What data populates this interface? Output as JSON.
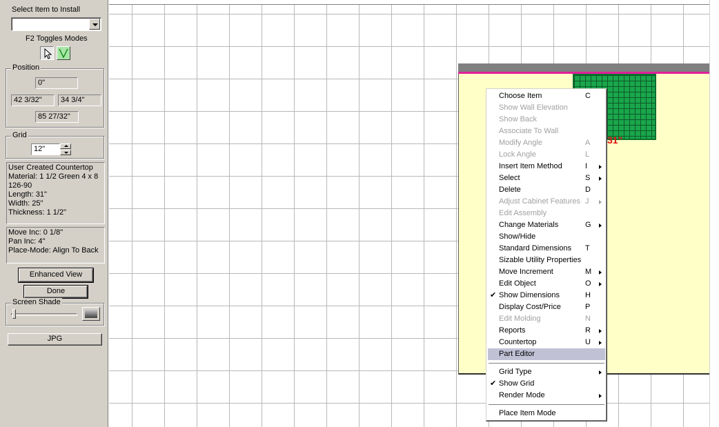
{
  "left_panel": {
    "select_item_label": "Select Item to Install",
    "select_item_value": "",
    "f2_toggles_label": "F2 Toggles Modes",
    "position": {
      "title": "Position",
      "z": "0\"",
      "x": "42 3/32\"",
      "y": "34 3/4\"",
      "h": "85 27/32\""
    },
    "grid": {
      "title": "Grid",
      "value": "12\""
    },
    "item_info": [
      "User Created Countertop",
      "Material: 1 1/2 Green 4 x 8",
      "126-90",
      "Length: 31\"",
      "Width: 25\"",
      "Thickness: 1 1/2\""
    ],
    "status_info": [
      "Move Inc: 0 1/8\"",
      "Pan Inc: 4\"",
      "Place-Mode: Align To Back"
    ],
    "enhanced_view_label": "Enhanced View",
    "done_label": "Done",
    "screen_shade_title": "Screen Shade",
    "jpg_label": "JPG"
  },
  "canvas": {
    "dimension_label": "31\"",
    "colors": {
      "countertop": "#ffffc8",
      "wall_line": "#e0209a",
      "green_material": "#1aa64b"
    }
  },
  "context_menu": {
    "items": [
      {
        "label": "Choose Item",
        "shortcut": "C",
        "enabled": true
      },
      {
        "label": "Show Wall Elevation",
        "shortcut": "",
        "enabled": false
      },
      {
        "label": "Show Back",
        "shortcut": "",
        "enabled": false
      },
      {
        "label": "Associate To Wall",
        "shortcut": "",
        "enabled": false
      },
      {
        "label": "Modify Angle",
        "shortcut": "A",
        "enabled": false
      },
      {
        "label": "Lock Angle",
        "shortcut": "L",
        "enabled": false
      },
      {
        "label": "Insert Item Method",
        "shortcut": "I",
        "enabled": true,
        "submenu": true
      },
      {
        "label": "Select",
        "shortcut": "S",
        "enabled": true,
        "submenu": true
      },
      {
        "label": "Delete",
        "shortcut": "D",
        "enabled": true
      },
      {
        "label": "Adjust Cabinet Features",
        "shortcut": "J",
        "enabled": false,
        "submenu": true
      },
      {
        "label": "Edit Assembly",
        "shortcut": "",
        "enabled": false
      },
      {
        "label": "Change Materials",
        "shortcut": "G",
        "enabled": true,
        "submenu": true
      },
      {
        "label": "Show/Hide",
        "shortcut": "",
        "enabled": true
      },
      {
        "label": "Standard Dimensions",
        "shortcut": "T",
        "enabled": true
      },
      {
        "label": "Sizable Utility Properties",
        "shortcut": "",
        "enabled": true
      },
      {
        "label": "Move Increment",
        "shortcut": "M",
        "enabled": true,
        "submenu": true
      },
      {
        "label": "Edit Object",
        "shortcut": "O",
        "enabled": true,
        "submenu": true
      },
      {
        "label": "Show Dimensions",
        "shortcut": "H",
        "enabled": true,
        "checked": true
      },
      {
        "label": "Display Cost/Price",
        "shortcut": "P",
        "enabled": true
      },
      {
        "label": "Edit Molding",
        "shortcut": "N",
        "enabled": false
      },
      {
        "label": "Reports",
        "shortcut": "R",
        "enabled": true,
        "submenu": true
      },
      {
        "label": "Countertop",
        "shortcut": "U",
        "enabled": true,
        "submenu": true
      },
      {
        "label": "Part Editor",
        "shortcut": "",
        "enabled": true,
        "highlighted": true
      },
      {
        "separator": true
      },
      {
        "label": "Grid Type",
        "shortcut": "",
        "enabled": true,
        "submenu": true
      },
      {
        "label": "Show Grid",
        "shortcut": "",
        "enabled": true,
        "checked": true
      },
      {
        "label": "Render Mode",
        "shortcut": "",
        "enabled": true,
        "submenu": true
      },
      {
        "separator": true
      },
      {
        "label": "Place Item Mode",
        "shortcut": "",
        "enabled": true
      }
    ]
  }
}
